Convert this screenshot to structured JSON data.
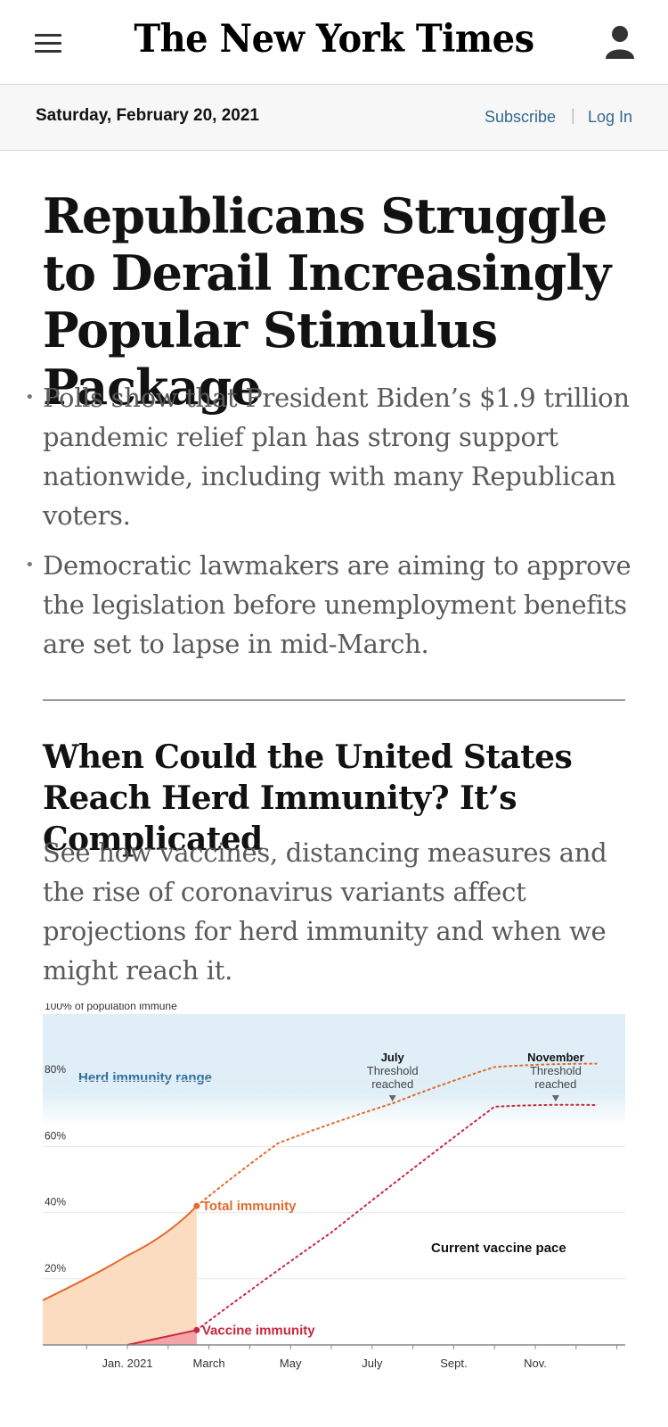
{
  "header": {
    "logo": "The New York Times",
    "menu_icon": "hamburger-menu-icon",
    "account_icon": "account-icon"
  },
  "datebar": {
    "date": "Saturday, February 20, 2021",
    "subscribe": "Subscribe",
    "separator": "|",
    "login": "Log In",
    "link_color": "#326891"
  },
  "lead_story": {
    "headline": "Republicans Struggle to Derail Increasingly Popular Stimulus Package",
    "bullets": [
      "Polls show that President Biden’s $1.9 trillion pandemic relief plan has strong support nationwide, including with many Republican voters.",
      "Democratic lawmakers are aiming to approve the legislation before unemployment benefits are set to lapse in mid-March."
    ]
  },
  "second_story": {
    "headline": "When Could the United States Reach Herd Immunity? It’s Complicated",
    "summary": "See how vaccines, distancing measures and the rise of coronavirus variants affect projections for herd immunity and when we might reach it."
  },
  "chart_data": {
    "type": "area",
    "ylabel": "100% of population immune",
    "ylim": [
      0,
      100
    ],
    "y_ticks": [
      "80%",
      "60%",
      "40%",
      "20%"
    ],
    "x_ticks": [
      "Jan. 2021",
      "March",
      "May",
      "July",
      "Sept.",
      "Nov."
    ],
    "band": {
      "label": "Herd immunity range",
      "from": 70,
      "to": 100,
      "color": "#dfeef7"
    },
    "series": [
      {
        "name": "Total immunity",
        "color": "#e06b2e",
        "fill": "#fcdcc1",
        "points": [
          [
            -1.0,
            13.5
          ],
          [
            0.0,
            27
          ],
          [
            1.7,
            42
          ]
        ],
        "projection": [
          [
            1.7,
            42
          ],
          [
            3.7,
            61
          ],
          [
            6.5,
            73
          ],
          [
            9.0,
            84
          ],
          [
            11.5,
            85
          ]
        ]
      },
      {
        "name": "Vaccine immunity",
        "color": "#c8283e",
        "fill": "#f4a3a6",
        "points": [
          [
            0.0,
            0
          ],
          [
            1.7,
            4.5
          ]
        ],
        "projection": [
          [
            1.7,
            4.5
          ],
          [
            5.0,
            34
          ],
          [
            9.0,
            72
          ],
          [
            11.5,
            72.5
          ]
        ]
      }
    ],
    "annotations": [
      {
        "month": "July",
        "text": "Threshold",
        "text2": "reached",
        "x": 6.5
      },
      {
        "month": "November",
        "text": "Threshold",
        "text2": "reached",
        "x": 10.5
      }
    ],
    "scenario_label": "Current vaccine pace"
  }
}
